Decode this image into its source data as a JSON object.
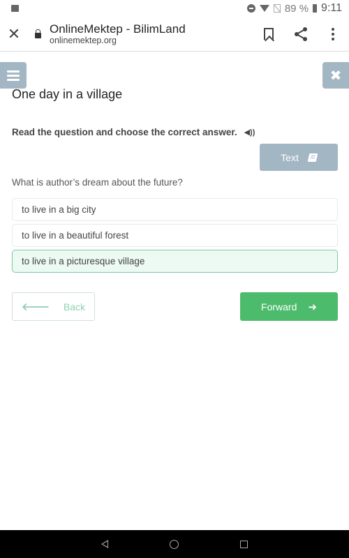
{
  "status_bar": {
    "battery_percent": "89 %",
    "time": "9:11"
  },
  "browser": {
    "page_title": "OnlineMektep - BilimLand",
    "url": "onlinemektep.org",
    "close_glyph": "✕"
  },
  "header": {
    "exit_glyph": "✖"
  },
  "lesson": {
    "title": "One day in a village",
    "instruction": "Read the question and choose the correct answer.",
    "speaker_glyph": "◀))",
    "text_button_label": "Text",
    "question": "What is author’s dream about the future?",
    "options": [
      {
        "label": "to live in a big city",
        "selected": false
      },
      {
        "label": "to live in a beautiful forest",
        "selected": false
      },
      {
        "label": "to live in a picturesque village",
        "selected": true
      }
    ]
  },
  "navigation": {
    "back_label": "Back",
    "back_arrow": "🡐",
    "forward_label": "Forward",
    "forward_arrow": "➜"
  },
  "colors": {
    "accent_green": "#4cbb6c",
    "selected_bg": "#ecfaf3",
    "muted_button": "#a3b6c3"
  }
}
